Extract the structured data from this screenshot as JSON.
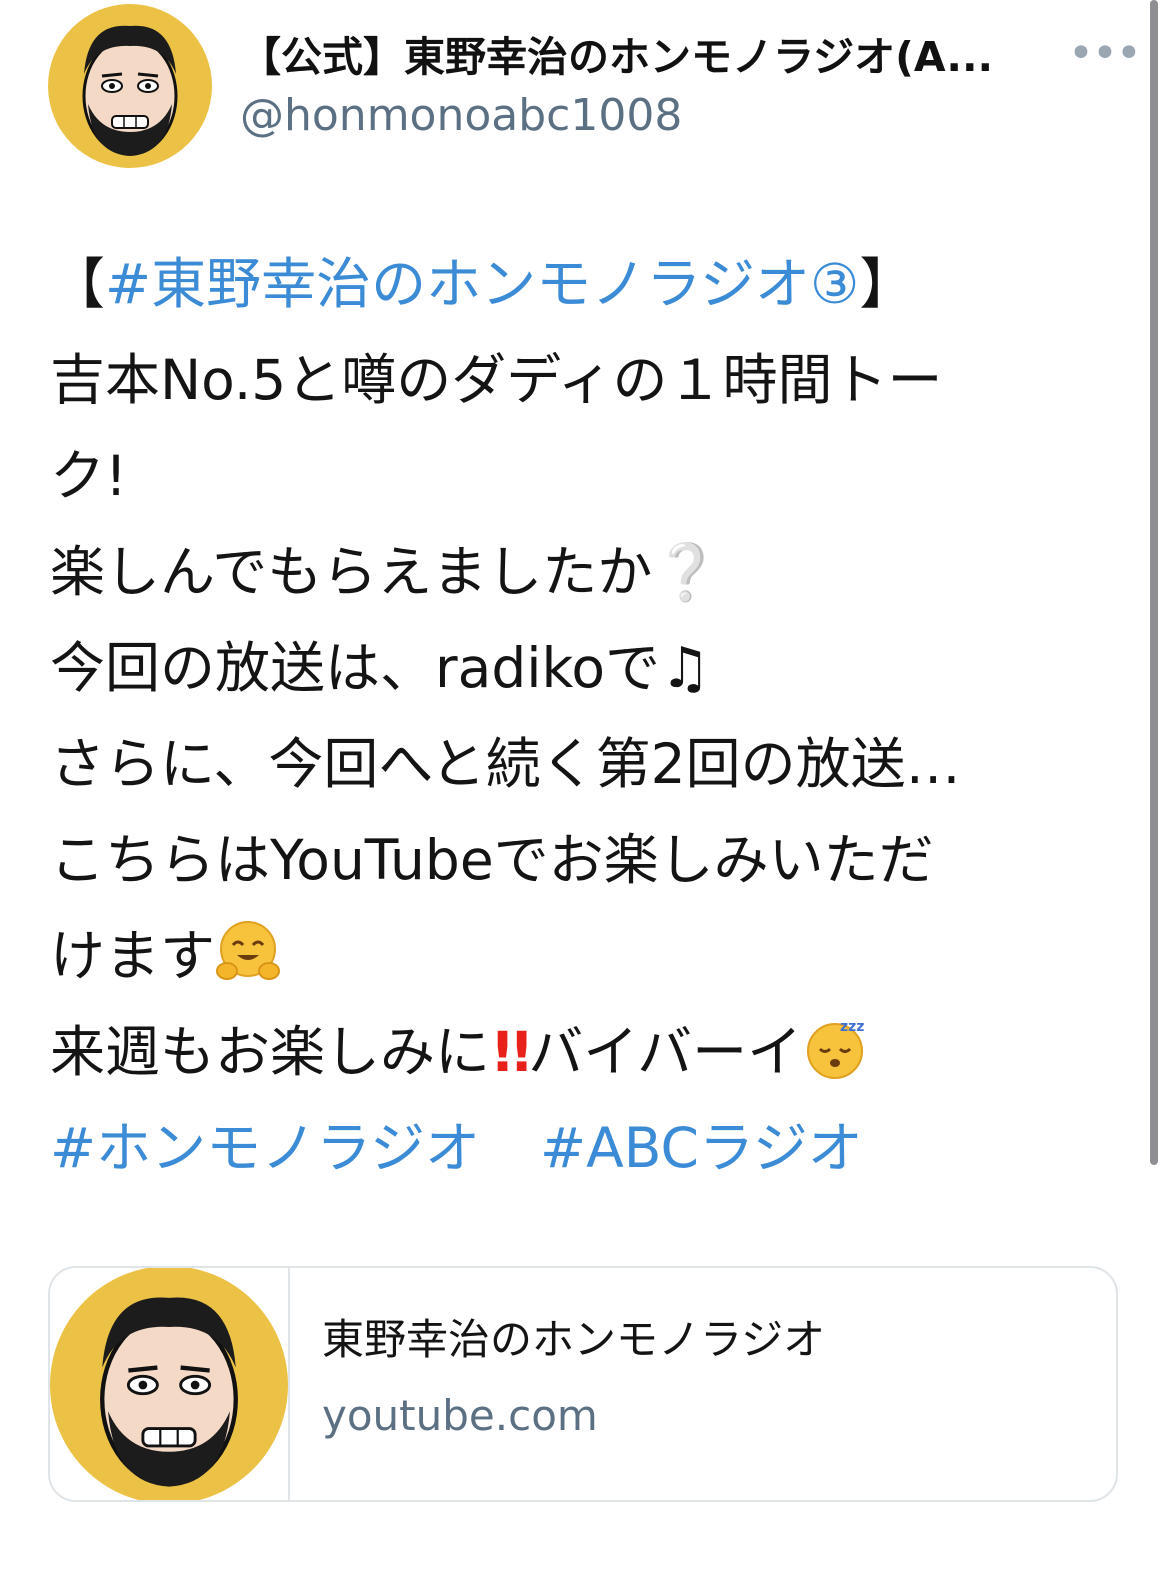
{
  "header": {
    "name": "【公式】東野幸治のホンモノラジオ(A...",
    "handle": "@honmonoabc1008",
    "more_icon": "more-dots-icon"
  },
  "tweet": {
    "l1_open": "【",
    "l1_tag": "#東野幸治のホンモノラジオ③",
    "l1_close": "】",
    "l2": "吉本No.5と噂のダディの１時間トー",
    "l3": "ク!",
    "l4": "楽しんでもらえましたか",
    "l4_emoji": "❔",
    "l5": "今回の放送は、radikoで",
    "l5_emoji": "♫",
    "l6": "さらに、今回へと続く第2回の放送…",
    "l7": "こちらはYouTubeでお楽しみいただ",
    "l8": "けます",
    "l8_emoji": "hugging-face-emoji",
    "l9_a": "来週もお楽しみに",
    "l9_bang": "!!",
    "l9_b": "バイバーイ",
    "l9_emoji": "sleeping-face-emoji",
    "tag1": "#ホンモノラジオ",
    "tag2": "#ABCラジオ"
  },
  "card": {
    "title": "東野幸治のホンモノラジオ",
    "domain": "youtube.com"
  },
  "colors": {
    "link": "#3b8bd6",
    "avatar_bg": "#ebc246",
    "secondary_text": "#5b7083"
  }
}
